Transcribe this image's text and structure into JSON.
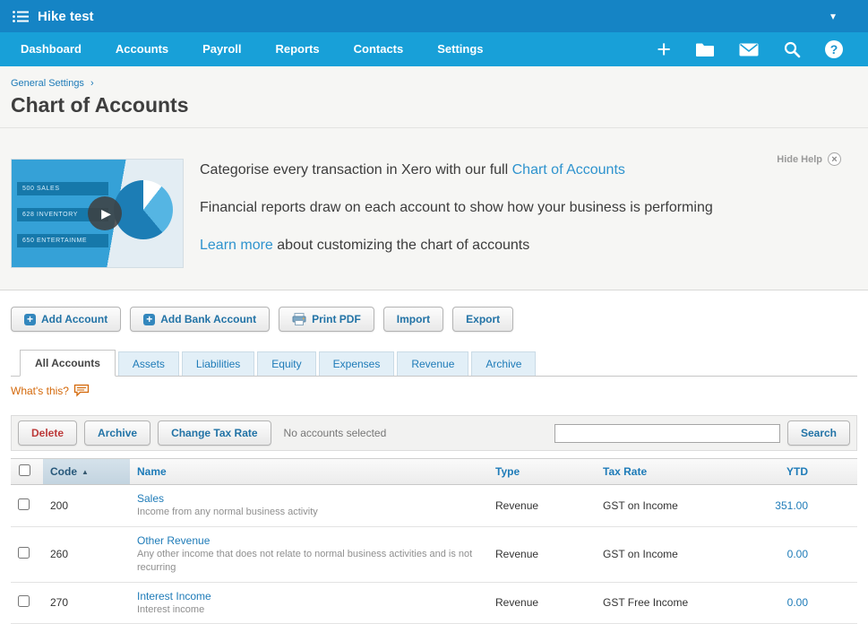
{
  "topbar": {
    "org_name": "Hike test"
  },
  "nav": {
    "items": [
      "Dashboard",
      "Accounts",
      "Payroll",
      "Reports",
      "Contacts",
      "Settings"
    ]
  },
  "breadcrumb": {
    "label": "General Settings"
  },
  "page": {
    "title": "Chart of Accounts"
  },
  "help": {
    "hide_label": "Hide Help",
    "line1_prefix": "Categorise every transaction in Xero with our full ",
    "line1_link": "Chart of Accounts",
    "line2": "Financial reports draw on each account to show how your business is performing",
    "line3_link": "Learn more",
    "line3_suffix": " about customizing the chart of accounts",
    "video_rows": [
      "500 SALES",
      "628 INVENTORY",
      "650 ENTERTAINME"
    ]
  },
  "toolbar": {
    "add_account": "Add Account",
    "add_bank_account": "Add Bank Account",
    "print_pdf": "Print PDF",
    "import_label": "Import",
    "export_label": "Export"
  },
  "tabs": [
    "All Accounts",
    "Assets",
    "Liabilities",
    "Equity",
    "Expenses",
    "Revenue",
    "Archive"
  ],
  "whats_this": "What's this?",
  "actionbar": {
    "delete_label": "Delete",
    "archive_label": "Archive",
    "change_tax_rate_label": "Change Tax Rate",
    "status": "No accounts selected",
    "search_label": "Search",
    "search_value": ""
  },
  "table": {
    "headers": {
      "code": "Code",
      "name": "Name",
      "type": "Type",
      "tax_rate": "Tax Rate",
      "ytd": "YTD"
    },
    "rows": [
      {
        "code": "200",
        "name": "Sales",
        "description": "Income from any normal business activity",
        "type": "Revenue",
        "tax_rate": "GST on Income",
        "ytd": "351.00"
      },
      {
        "code": "260",
        "name": "Other Revenue",
        "description": "Any other income that does not relate to normal business activities and is not recurring",
        "type": "Revenue",
        "tax_rate": "GST on Income",
        "ytd": "0.00"
      },
      {
        "code": "270",
        "name": "Interest Income",
        "description": "Interest income",
        "type": "Revenue",
        "tax_rate": "GST Free Income",
        "ytd": "0.00"
      }
    ]
  },
  "icons": {
    "caret_down": "▾",
    "breadcrumb_sep": "›",
    "close": "×",
    "question": "?",
    "plus": "+",
    "play": "▶",
    "sort_asc": "▲"
  },
  "colors": {
    "topbar_blue": "#1584c5",
    "nav_blue": "#18a0d8",
    "link_blue": "#1e7bb8",
    "delete_red": "#bc3a3a",
    "orange": "#d4690b"
  }
}
